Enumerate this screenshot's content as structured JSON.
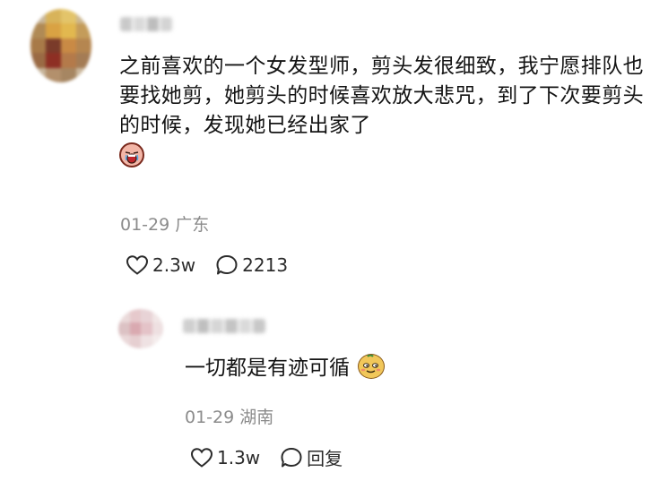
{
  "main_comment": {
    "text": "之前喜欢的一个女发型师，剪头发很细致，我宁愿排队也要找她剪，她剪头的时候喜欢放大悲咒，到了下次要剪头的时候，发现她已经出家了",
    "emoji_icon": "crying-face-icon",
    "date": "01-29",
    "location": "广东",
    "likes": "2.3w",
    "replies": "2213"
  },
  "reply": {
    "text": "一切都是有迹可循",
    "emoji_icon": "smug-face-icon",
    "date": "01-29",
    "location": "湖南",
    "likes": "1.3w",
    "reply_label": "回复"
  },
  "colors": {
    "meta_gray": "#8b8b8b",
    "text": "#141414",
    "icon": "#2b2b2b"
  }
}
